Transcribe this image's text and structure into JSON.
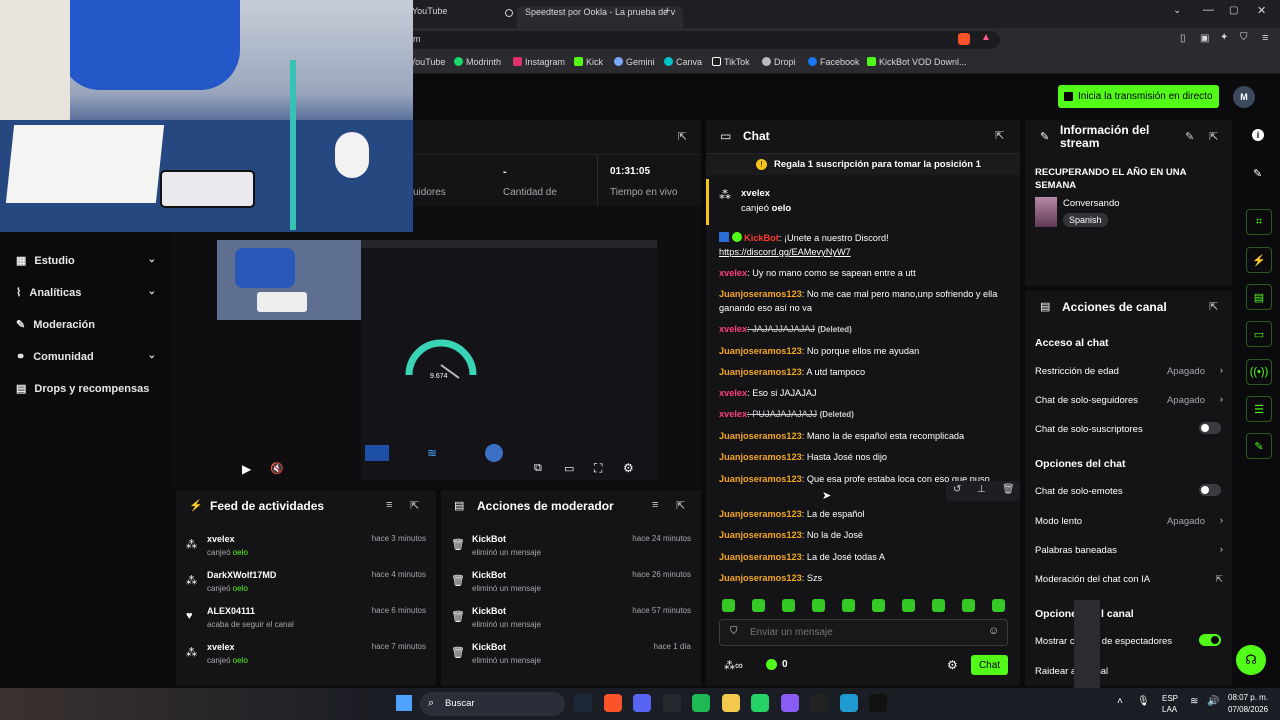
{
  "browser": {
    "tabs": [
      {
        "label": "YouTube"
      },
      {
        "label": "Speedtest por Ookla - La prueba de v"
      }
    ],
    "address_fragment": "m",
    "bookmarks": [
      {
        "label": "YouTube",
        "color": "#ff0000"
      },
      {
        "label": "Modrinth",
        "color": "#1bd96a"
      },
      {
        "label": "Instagram",
        "color": "#e1306c"
      },
      {
        "label": "Kick",
        "color": "#53fc18"
      },
      {
        "label": "Gemini",
        "color": "#7aa7ff"
      },
      {
        "label": "Canva",
        "color": "#00c4cc"
      },
      {
        "label": "TikTok",
        "color": "#ffffff"
      },
      {
        "label": "Dropi",
        "color": "#bbbbbb"
      },
      {
        "label": "Facebook",
        "color": "#1877f2"
      },
      {
        "label": "KickBot VOD Downl...",
        "color": "#53fc18"
      }
    ]
  },
  "topbar": {
    "golive_label": "Inicia la transmisión en directo",
    "accent": "#53fc18"
  },
  "sidebar": {
    "items": [
      {
        "label": "Estudio"
      },
      {
        "label": "Analíticas"
      },
      {
        "label": "Moderación"
      },
      {
        "label": "Comunidad"
      },
      {
        "label": "Drops y recompensas"
      }
    ]
  },
  "stats": {
    "followers_label": "uidores",
    "viewers_value": "-",
    "viewers_label": "Cantidad de",
    "uptime_value": "01:31:05",
    "uptime_label": "Tiempo en vivo"
  },
  "preview": {
    "speed_value": "9.674"
  },
  "activity_feed": {
    "title": "Feed de actividades",
    "items": [
      {
        "name": "xvelex",
        "action": "canjeó ",
        "item": "oelo",
        "time": "hace 3 minutos",
        "icon": "redeem-icon"
      },
      {
        "name": "DarkXWolf17MD",
        "action": "canjeó ",
        "item": "oelo",
        "time": "hace 4 minutos",
        "icon": "redeem-icon"
      },
      {
        "name": "ALEX04111",
        "action": "acaba de seguir el canal",
        "item": "",
        "time": "hace 6 minutos",
        "icon": "heart-icon"
      },
      {
        "name": "xvelex",
        "action": "canjeó ",
        "item": "oelo",
        "time": "hace 7 minutos",
        "icon": "redeem-icon"
      }
    ]
  },
  "mod_actions": {
    "title": "Acciones de moderador",
    "items": [
      {
        "name": "KickBot",
        "action": "eliminó un mensaje",
        "time": "hace 24 minutos"
      },
      {
        "name": "KickBot",
        "action": "eliminó un mensaje",
        "time": "hace 26 minutos"
      },
      {
        "name": "KickBot",
        "action": "eliminó un mensaje",
        "time": "hace 57 minutos"
      },
      {
        "name": "KickBot",
        "action": "eliminó un mensaje",
        "time": "hace 1 día"
      }
    ]
  },
  "chat": {
    "title": "Chat",
    "pinned": "Regala 1 suscripción para tomar la posición 1",
    "redeem": {
      "user": "xvelex",
      "action": "canjeó ",
      "item": "oelo"
    },
    "kickbot": {
      "user": "KickBot",
      "text": ": ¡Unete a nuestro Discord!",
      "link": "https://discord.gg/EAMevyNyW7"
    },
    "messages": [
      {
        "user": "xvelex",
        "color": "pink",
        "text": ": Uy no mano como se sapean entre a utt",
        "deleted": false
      },
      {
        "user": "Juanjoseramos123",
        "color": "orange",
        "text": ": No me cae mal pero mano,unp sofriendo y ella ganando eso así no va",
        "deleted": false
      },
      {
        "user": "xvelex",
        "color": "pink",
        "text": ": JAJAJJAJAJAJ",
        "deleted": true
      },
      {
        "user": "Juanjoseramos123",
        "color": "orange",
        "text": ": No porque ellos me ayudan",
        "deleted": false
      },
      {
        "user": "Juanjoseramos123",
        "color": "orange",
        "text": ": A utd tampoco",
        "deleted": false
      },
      {
        "user": "xvelex",
        "color": "pink",
        "text": ": Eso si JAJAJAJ",
        "deleted": false
      },
      {
        "user": "xvelex",
        "color": "pink",
        "text": ": PUJAJAJAJAJJ",
        "deleted": true
      },
      {
        "user": "Juanjoseramos123",
        "color": "orange",
        "text": ": Mano la de español esta recomplicada",
        "deleted": false
      },
      {
        "user": "Juanjoseramos123",
        "color": "orange",
        "text": ": Hasta José nos dijo",
        "deleted": false
      },
      {
        "user": "Juanjoseramos123",
        "color": "orange",
        "text": ": Que esa profe estaba loca con eso que puso",
        "deleted": false
      },
      {
        "user": "Juanjoseramos123",
        "color": "orange",
        "text": ": La de español",
        "deleted": false
      },
      {
        "user": "Juanjoseramos123",
        "color": "orange",
        "text": ": No la de José",
        "deleted": false
      },
      {
        "user": "Juanjoseramos123",
        "color": "orange",
        "text": ": La de José todas A",
        "deleted": false
      },
      {
        "user": "Juanjoseramos123",
        "color": "orange",
        "text": ": Szs",
        "deleted": false
      }
    ],
    "deleted_tag": "(Deleted)",
    "input_placeholder": "Enviar un mensaje",
    "send_label": "Chat",
    "points": "0"
  },
  "stream_info": {
    "title": "Información del stream",
    "stream_title": "RECUPERANDO EL AÑO EN UNA SEMANA",
    "category": "Conversando",
    "language": "Spanish"
  },
  "channel_actions": {
    "title": "Acciones de canal",
    "chat_access": "Acceso al chat",
    "age_restriction": {
      "label": "Restricción de edad",
      "value": "Apagado"
    },
    "followers_only": {
      "label": "Chat de solo-seguidores",
      "value": "Apagado"
    },
    "subs_only": {
      "label": "Chat de solo-suscriptores"
    },
    "chat_options": "Opciones del chat",
    "emotes_only": {
      "label": "Chat de solo-emotes"
    },
    "slow_mode": {
      "label": "Modo lento",
      "value": "Apagado"
    },
    "banned_words": {
      "label": "Palabras baneadas"
    },
    "ai_mod": {
      "label": "Moderación del chat con IA"
    },
    "channel_options_a": "Opcione",
    "channel_options_b": "l canal",
    "show_viewers_a": "Mostrar c",
    "show_viewers_b": "ad de espectadores",
    "raid_a": "Raidear a",
    "raid_b": "anal"
  },
  "taskbar": {
    "search_label": "Buscar",
    "lang1": "ESP",
    "lang2": "LAA",
    "time": "08:07 p. m.",
    "date": "07/08/2026"
  }
}
